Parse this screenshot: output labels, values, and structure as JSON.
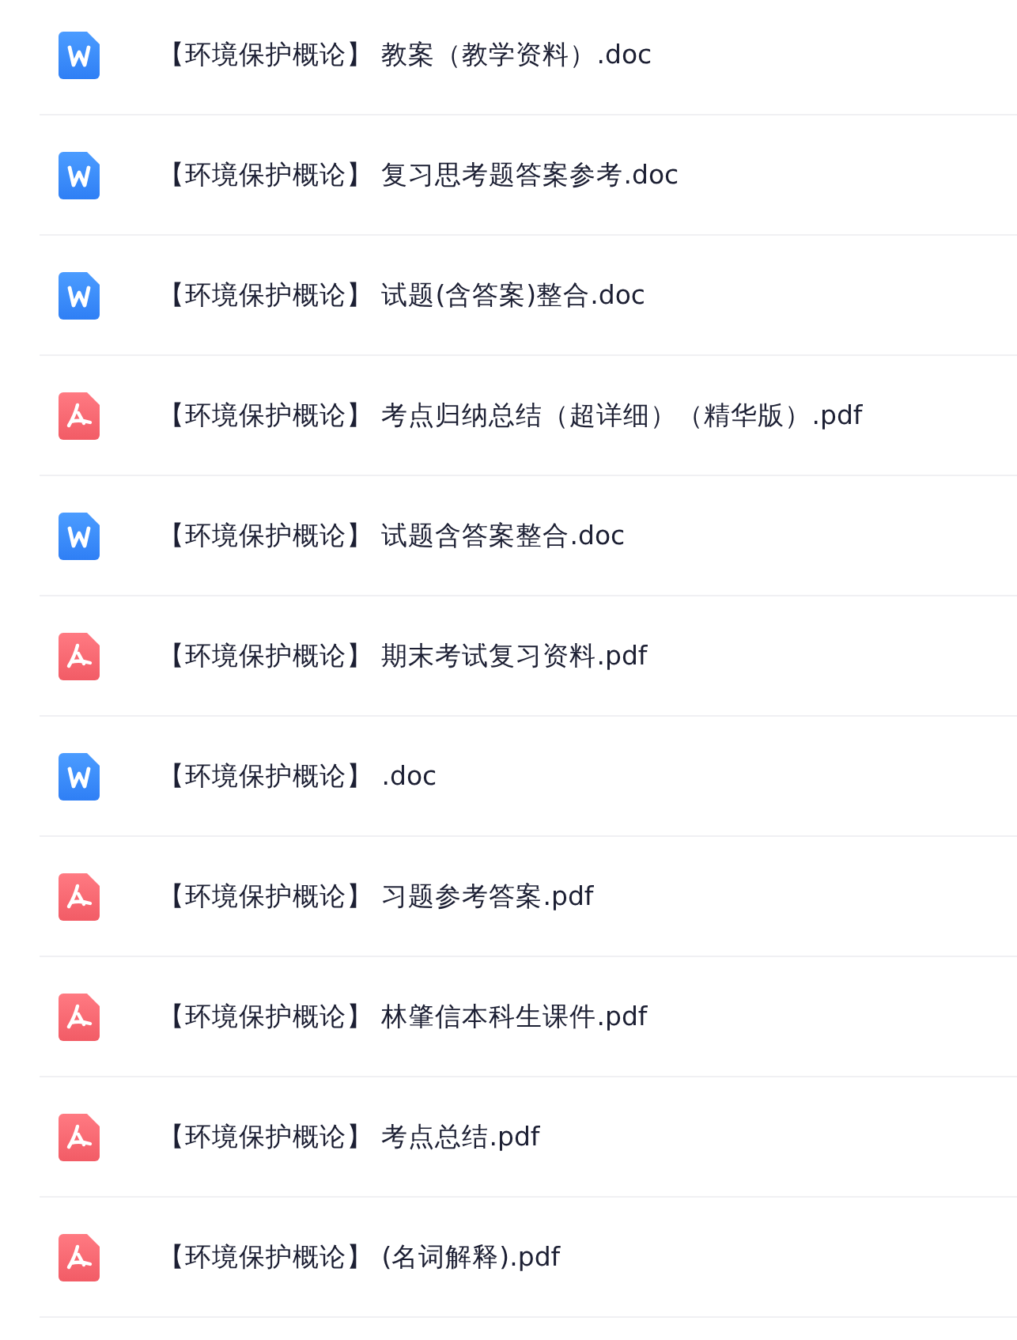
{
  "files": [
    {
      "kind": "doc",
      "name": "【环境保护概论】 教案（教学资料）.doc"
    },
    {
      "kind": "doc",
      "name": "【环境保护概论】 复习思考题答案参考.doc"
    },
    {
      "kind": "doc",
      "name": "【环境保护概论】 试题(含答案)整合.doc"
    },
    {
      "kind": "pdf",
      "name": "【环境保护概论】 考点归纳总结（超详细）（精华版）.pdf"
    },
    {
      "kind": "doc",
      "name": "【环境保护概论】 试题含答案整合.doc"
    },
    {
      "kind": "pdf",
      "name": "【环境保护概论】 期末考试复习资料.pdf"
    },
    {
      "kind": "doc",
      "name": "【环境保护概论】 .doc"
    },
    {
      "kind": "pdf",
      "name": "【环境保护概论】 习题参考答案.pdf"
    },
    {
      "kind": "pdf",
      "name": "【环境保护概论】 林肇信本科生课件.pdf"
    },
    {
      "kind": "pdf",
      "name": "【环境保护概论】 考点总结.pdf"
    },
    {
      "kind": "pdf",
      "name": "【环境保护概论】 (名词解释).pdf"
    }
  ]
}
